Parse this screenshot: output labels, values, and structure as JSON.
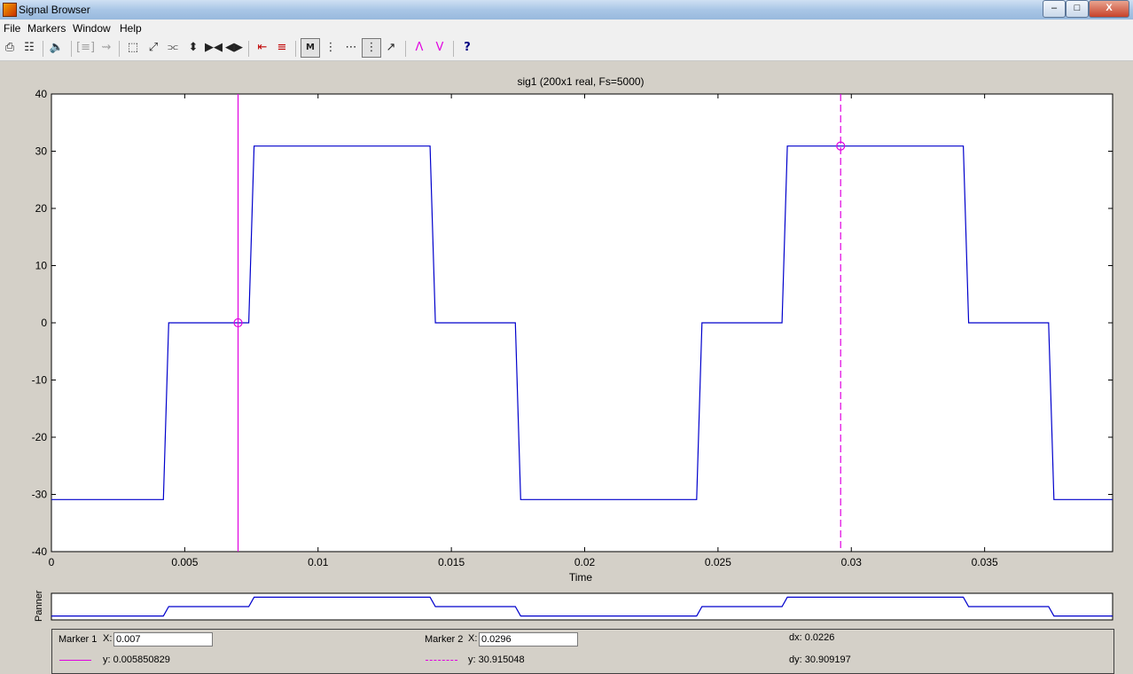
{
  "window": {
    "title": "Signal Browser",
    "minimize": "–",
    "maximize": "□",
    "close": "X"
  },
  "menu": [
    "File",
    "Markers",
    "Window",
    "Help"
  ],
  "toolbar": {
    "icons": [
      "print-icon",
      "print-preview-icon",
      "play-sound-icon",
      "array-signals-icon",
      "select-icon",
      "mouse-zoom-icon",
      "zoom-in-x-icon",
      "zoom-out-x-icon",
      "zoom-in-y-icon",
      "zoom-out-y-icon",
      "zoom-full-view-icon",
      "zoom-selected-icon",
      "markers-toggle-icon",
      "vertical-markers-icon",
      "horizontal-markers-icon",
      "track-markers-icon",
      "slope-markers-icon",
      "peaks-icon",
      "valleys-icon",
      "whats-this-icon"
    ]
  },
  "plot": {
    "title": "sig1 (200x1 real, Fs=5000)",
    "xlabel": "Time",
    "panner_label": "Panner"
  },
  "chart_data": {
    "type": "line",
    "title": "sig1 (200x1 real, Fs=5000)",
    "xlabel": "Time",
    "ylabel": "",
    "xlim": [
      0,
      0.0398
    ],
    "ylim": [
      -40,
      40
    ],
    "x_ticks": [
      "0",
      "0.005",
      "0.01",
      "0.015",
      "0.02",
      "0.025",
      "0.03",
      "0.035"
    ],
    "y_ticks": [
      "40",
      "30",
      "20",
      "10",
      "0",
      "-10",
      "-20",
      "-30",
      "-40"
    ],
    "grid": false,
    "line_color": "#0000cc",
    "series": [
      {
        "x": [
          0,
          0.0042,
          0.0044,
          0.0074,
          0.0076,
          0.0142,
          0.0144,
          0.0174,
          0.0176,
          0.0242,
          0.0244,
          0.0274,
          0.0276,
          0.0342,
          0.0344,
          0.0374,
          0.0376,
          0.0398
        ],
        "y": [
          -30.9,
          -30.9,
          0,
          0,
          30.9,
          30.9,
          0,
          0,
          -30.9,
          -30.9,
          0,
          0,
          30.9,
          30.9,
          0,
          0,
          -30.9,
          -30.9
        ]
      }
    ],
    "markers": [
      {
        "name": "Marker 1",
        "x": 0.007,
        "y": 0.005850829,
        "style": "solid",
        "color": "#e000e0"
      },
      {
        "name": "Marker 2",
        "x": 0.0296,
        "y": 30.915048,
        "style": "dashed",
        "color": "#e000e0"
      }
    ]
  },
  "markers_panel": {
    "marker1": {
      "label": "Marker 1",
      "x_label": "X:",
      "x_value": "0.007",
      "y_text": "y: 0.005850829"
    },
    "marker2": {
      "label": "Marker 2",
      "x_label": "X:",
      "x_value": "0.0296",
      "y_text": "y: 30.915048"
    },
    "dx": "dx: 0.0226",
    "dy": "dy: 30.909197"
  }
}
